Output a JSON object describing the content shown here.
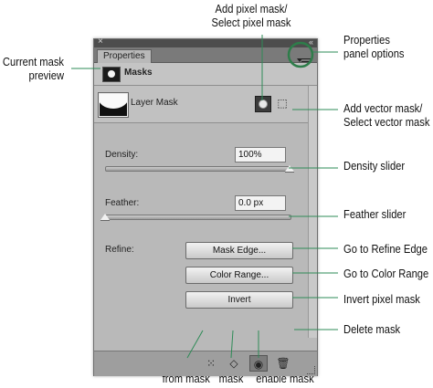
{
  "callouts": {
    "current_mask_preview": "Current mask\npreview",
    "add_pixel_mask": "Add pixel mask/\nSelect pixel mask",
    "properties_panel_options": "Properties\npanel options",
    "add_vector_mask": "Add vector mask/\nSelect vector mask",
    "density_slider": "Density slider",
    "feather_slider": "Feather slider",
    "go_refine_edge": "Go to Refine Edge",
    "go_color_range": "Go to Color Range",
    "invert_pixel_mask": "Invert pixel mask",
    "delete_mask": "Delete mask",
    "load_selection": "Load selection\nfrom mask",
    "apply_mask": "Apply\nmask",
    "disable_enable_mask": "Disable/\nenable mask"
  },
  "panel": {
    "close_glyph": "×",
    "collapse_glyph": "«",
    "tab_label": "Properties",
    "masks_label": "Masks",
    "layer_mask_label": "Layer Mask",
    "vector_mask_glyph": "⬚",
    "density_label": "Density:",
    "density_value": "100%",
    "feather_label": "Feather:",
    "feather_value": "0.0 px",
    "refine_label": "Refine:",
    "mask_edge_label": "Mask Edge...",
    "color_range_label": "Color Range...",
    "invert_label": "Invert",
    "density_level_percent": 100,
    "feather_level_percent": 0,
    "bottom_icons": {
      "load_selection": "⁙",
      "apply_mask": "◇",
      "disable_mask": "◉",
      "delete_mask": "🗑"
    }
  },
  "colors": {
    "panel_bg": "#b9b9b9",
    "highlight_ring": "#2e7d4a",
    "callout_line": "#2e8b57"
  }
}
